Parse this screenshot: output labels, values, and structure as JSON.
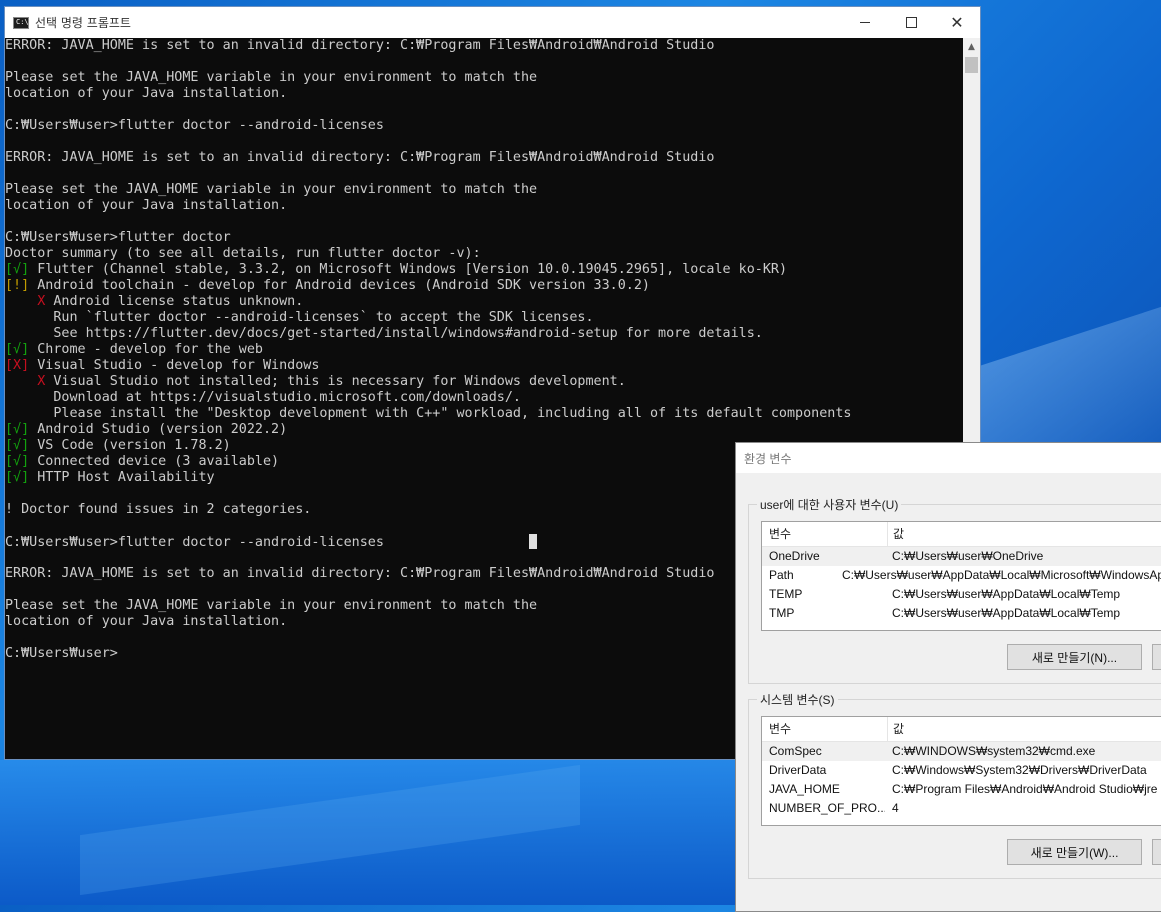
{
  "cmd": {
    "title": "선택 명령 프롬프트",
    "app_icon_text": "C:\\",
    "close_glyph": "✕",
    "lines": [
      [
        {
          "t": "ERROR: JAVA_HOME is set to an invalid directory: C:₩Program Files₩Android₩Android Studio"
        }
      ],
      [
        {
          "t": ""
        }
      ],
      [
        {
          "t": "Please set the JAVA_HOME variable in your environment to match the"
        }
      ],
      [
        {
          "t": "location of your Java installation."
        }
      ],
      [
        {
          "t": ""
        }
      ],
      [
        {
          "t": "C:₩Users₩user>flutter doctor --android-licenses"
        }
      ],
      [
        {
          "t": ""
        }
      ],
      [
        {
          "t": "ERROR: JAVA_HOME is set to an invalid directory: C:₩Program Files₩Android₩Android Studio"
        }
      ],
      [
        {
          "t": ""
        }
      ],
      [
        {
          "t": "Please set the JAVA_HOME variable in your environment to match the"
        }
      ],
      [
        {
          "t": "location of your Java installation."
        }
      ],
      [
        {
          "t": ""
        }
      ],
      [
        {
          "t": "C:₩Users₩user>flutter doctor"
        }
      ],
      [
        {
          "t": "Doctor summary (to see all details, run flutter doctor -v):"
        }
      ],
      [
        {
          "t": "[√]",
          "c": "g"
        },
        {
          "t": " Flutter (Channel stable, 3.3.2, on Microsoft Windows [Version 10.0.19045.2965], locale ko-KR)"
        }
      ],
      [
        {
          "t": "[!]",
          "c": "ye"
        },
        {
          "t": " Android toolchain - develop for Android devices (Android SDK version 33.0.2)"
        }
      ],
      [
        {
          "t": "    "
        },
        {
          "t": "X",
          "c": "r"
        },
        {
          "t": " Android license status unknown."
        }
      ],
      [
        {
          "t": "      Run `flutter doctor --android-licenses` to accept the SDK licenses."
        }
      ],
      [
        {
          "t": "      See https://flutter.dev/docs/get-started/install/windows#android-setup for more details."
        }
      ],
      [
        {
          "t": "[√]",
          "c": "g"
        },
        {
          "t": " Chrome - develop for the web"
        }
      ],
      [
        {
          "t": "[X]",
          "c": "r"
        },
        {
          "t": " Visual Studio - develop for Windows"
        }
      ],
      [
        {
          "t": "    "
        },
        {
          "t": "X",
          "c": "r"
        },
        {
          "t": " Visual Studio not installed; this is necessary for Windows development."
        }
      ],
      [
        {
          "t": "      Download at https://visualstudio.microsoft.com/downloads/."
        }
      ],
      [
        {
          "t": "      Please install the \"Desktop development with C++\" workload, including all of its default components"
        }
      ],
      [
        {
          "t": "[√]",
          "c": "g"
        },
        {
          "t": " Android Studio (version 2022.2)"
        }
      ],
      [
        {
          "t": "[√]",
          "c": "g"
        },
        {
          "t": " VS Code (version 1.78.2)"
        }
      ],
      [
        {
          "t": "[√]",
          "c": "g"
        },
        {
          "t": " Connected device (3 available)"
        }
      ],
      [
        {
          "t": "[√]",
          "c": "g"
        },
        {
          "t": " HTTP Host Availability"
        }
      ],
      [
        {
          "t": ""
        }
      ],
      [
        {
          "t": "! Doctor found issues in 2 categories."
        }
      ],
      [
        {
          "t": ""
        }
      ],
      [
        {
          "t": "C:₩Users₩user>flutter doctor --android-licenses"
        },
        {
          "t": "                  "
        },
        {
          "cursor": true
        }
      ],
      [
        {
          "t": ""
        }
      ],
      [
        {
          "t": "ERROR: JAVA_HOME is set to an invalid directory: C:₩Program Files₩Android₩Android Studio"
        }
      ],
      [
        {
          "t": ""
        }
      ],
      [
        {
          "t": "Please set the JAVA_HOME variable in your environment to match the"
        }
      ],
      [
        {
          "t": "location of your Java installation."
        }
      ],
      [
        {
          "t": ""
        }
      ],
      [
        {
          "t": "C:₩Users₩user>"
        }
      ]
    ],
    "colors": {
      "background": "#0c0c0c",
      "text": "#cccccc",
      "green": "#13a10e",
      "red": "#c50f1f",
      "yellow": "#c19c00"
    }
  },
  "env": {
    "title": "환경 변수",
    "user_group_label": "user에 대한 사용자 변수(U)",
    "system_group_label": "시스템 변수(S)",
    "col_name": "변수",
    "col_value": "값",
    "user_vars": [
      {
        "name": "OneDrive",
        "value": "C:₩Users₩user₩OneDrive"
      },
      {
        "name": "Path",
        "value": "C:₩Users₩user₩AppData₩Local₩Microsoft₩WindowsApps;"
      },
      {
        "name": "TEMP",
        "value": "C:₩Users₩user₩AppData₩Local₩Temp"
      },
      {
        "name": "TMP",
        "value": "C:₩Users₩user₩AppData₩Local₩Temp"
      }
    ],
    "system_vars": [
      {
        "name": "ComSpec",
        "value": "C:₩WINDOWS₩system32₩cmd.exe"
      },
      {
        "name": "DriverData",
        "value": "C:₩Windows₩System32₩Drivers₩DriverData"
      },
      {
        "name": "JAVA_HOME",
        "value": "C:₩Program Files₩Android₩Android Studio₩jre"
      },
      {
        "name": "NUMBER_OF_PRO...",
        "value": "4"
      }
    ],
    "user_new_button": "새로 만들기(N)...",
    "system_new_button": "새로 만들기(W)..."
  }
}
